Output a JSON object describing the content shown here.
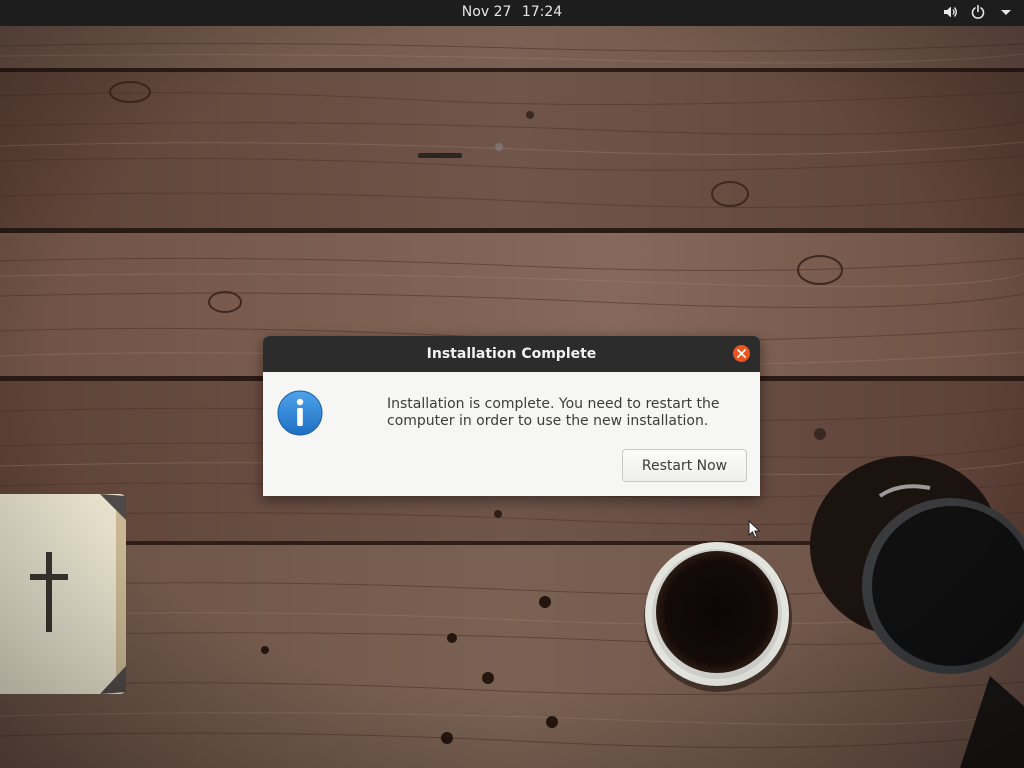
{
  "topbar": {
    "date": "Nov 27",
    "time": "17:24",
    "icons": [
      "volume-icon",
      "power-icon",
      "dropdown-arrow-icon"
    ]
  },
  "dialog": {
    "title": "Installation Complete",
    "icon": "info-icon",
    "message_line1": "Installation is complete. You need to restart the",
    "message_line2": "computer in order to use the new installation.",
    "restart_label": "Restart Now",
    "close_icon": "close-icon"
  },
  "colors": {
    "topbar": "#1d1d1d",
    "dialog_titlebar": "#2c2c2c",
    "dialog_body": "#f6f6f5",
    "close_button": "#e95420",
    "info_icon": "#2f86d6"
  }
}
